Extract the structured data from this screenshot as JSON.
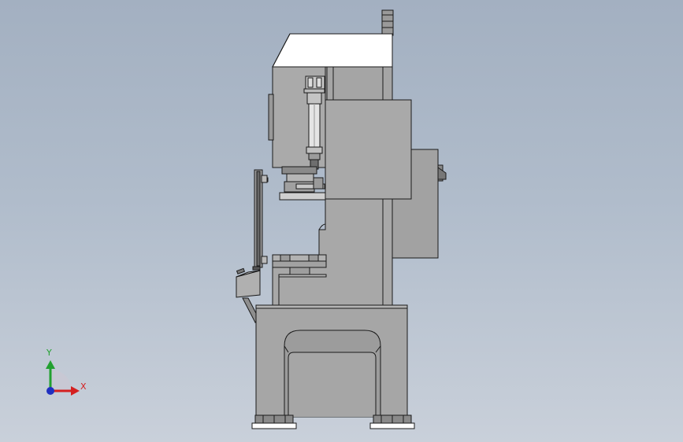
{
  "viewport": {
    "background_top": "#a3b0c1",
    "background_bottom": "#c9d0da"
  },
  "model": {
    "part_fill": "#a8a8a8",
    "part_fill_light": "#b3b3b3",
    "part_fill_dark": "#8f8f8f",
    "edge_color": "#1a1a1a",
    "top_cover_fill": "#ffffff"
  },
  "triad": {
    "x_label": "X",
    "y_label": "Y",
    "x_color": "#d42020",
    "y_color": "#22a030",
    "z_color": "#2030c0"
  }
}
